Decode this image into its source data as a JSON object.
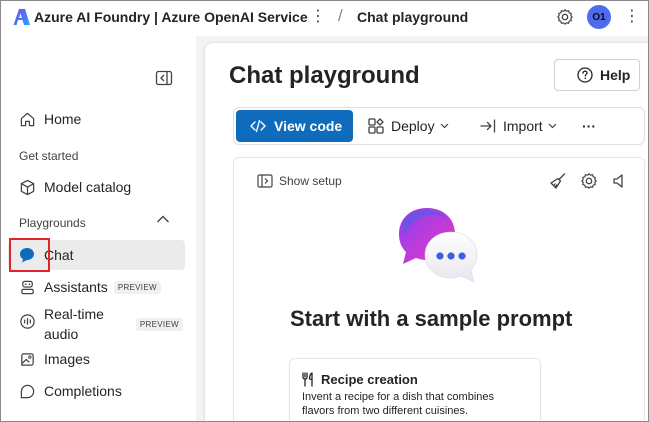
{
  "topbar": {
    "app_title": "Azure AI Foundry | Azure OpenAI Service",
    "separator": "/",
    "current_page": "Chat playground",
    "avatar_initials": "O1"
  },
  "sidebar": {
    "items": [
      {
        "label": "Home",
        "icon": "home-icon"
      },
      {
        "label": "Model catalog",
        "icon": "cube-icon"
      },
      {
        "label": "Chat",
        "icon": "chat-icon",
        "active": true
      },
      {
        "label": "Assistants",
        "icon": "assistant-icon",
        "badge": "PREVIEW"
      },
      {
        "label": "Real-time audio",
        "icon": "audio-icon",
        "badge": "PREVIEW"
      },
      {
        "label": "Images",
        "icon": "image-icon"
      },
      {
        "label": "Completions",
        "icon": "completions-icon"
      }
    ],
    "section_get_started": "Get started",
    "section_playgrounds": "Playgrounds",
    "realtime_line1": "Real-time",
    "realtime_line2": "audio"
  },
  "main": {
    "page_title": "Chat playground",
    "help_label": "Help",
    "toolbar": {
      "view_code": "View code",
      "deploy": "Deploy",
      "import": "Import",
      "more": "···"
    },
    "panel": {
      "show_setup": "Show setup",
      "hero_title": "Start with a sample prompt",
      "sample": {
        "title": "Recipe creation",
        "description": "Invent a recipe for a dish that combines flavors from two different cuisines."
      }
    }
  },
  "colors": {
    "primary": "#0f6cbd",
    "avatar": "#4f6bed",
    "highlight": "#e0242b",
    "active_bg": "#ebebeb"
  }
}
